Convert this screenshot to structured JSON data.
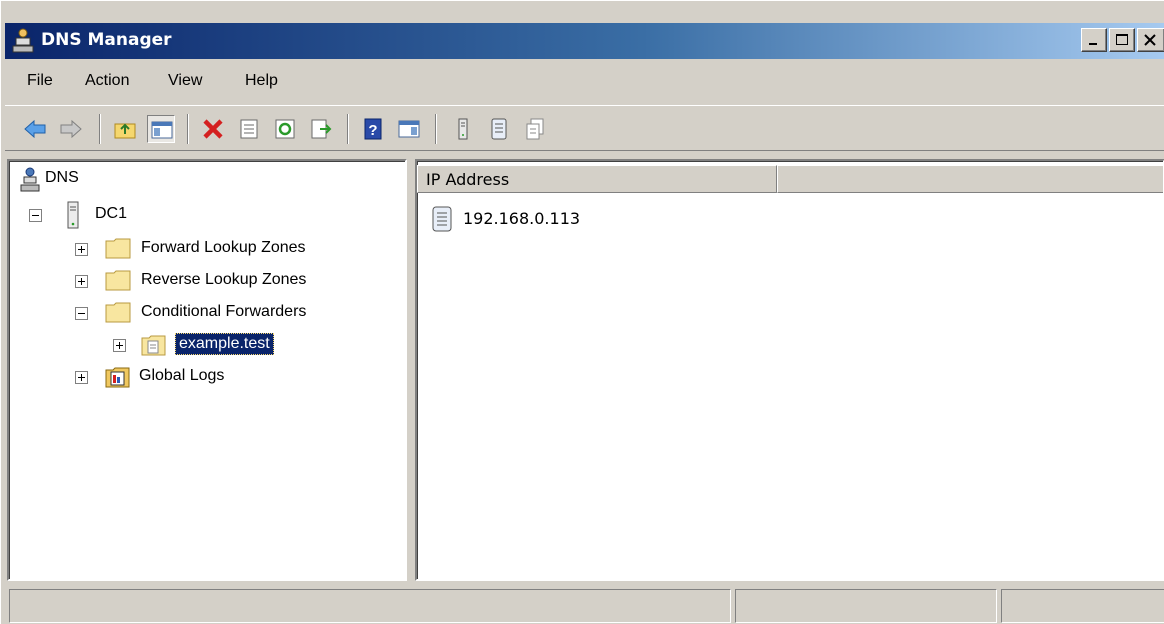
{
  "window": {
    "title": "DNS Manager"
  },
  "menu": {
    "items": [
      "File",
      "Action",
      "View",
      "Help"
    ]
  },
  "tree": {
    "root": "DNS",
    "server": "DC1",
    "forward": "Forward Lookup Zones",
    "reverse": "Reverse Lookup Zones",
    "conditional": "Conditional Forwarders",
    "example": "example.test",
    "global_logs": "Global Logs"
  },
  "list": {
    "columns": [
      "IP Address",
      ""
    ],
    "rows": [
      {
        "ip": "192.168.0.113"
      }
    ]
  },
  "status": {
    "panels": [
      "",
      "",
      ""
    ]
  },
  "colors": {
    "title_active": "#0a246a",
    "selection": "#0a246a",
    "chrome": "#d4d0c8"
  }
}
